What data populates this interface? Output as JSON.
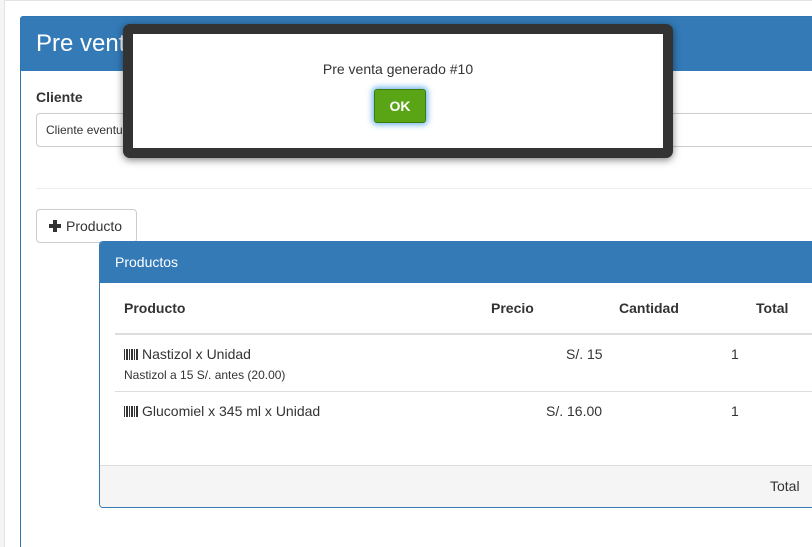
{
  "page": {
    "title": "Pre venta"
  },
  "form": {
    "cliente_label": "Cliente",
    "cliente_value": "Cliente eventual",
    "add_product_label": "Producto"
  },
  "products_panel": {
    "title": "Productos",
    "columns": [
      "Producto",
      "Precio",
      "Cantidad",
      "Total"
    ],
    "rows": [
      {
        "name": "Nastizol x Unidad",
        "note": "Nastizol a 15 S/. antes (20.00)",
        "price": "S/. 15",
        "quantity": "1"
      },
      {
        "name": "Glucomiel x 345 ml x Unidad",
        "note": "",
        "price": "S/. 16.00",
        "quantity": "1"
      }
    ],
    "footer_total_label": "Total"
  },
  "alert": {
    "message": "Pre venta generado #10",
    "ok_label": "OK"
  },
  "colors": {
    "primary": "#337ab7",
    "ok_button": "#5aa516",
    "modal_border": "#333333"
  },
  "icons": {
    "add": "plus-icon",
    "product": "barcode-icon"
  }
}
